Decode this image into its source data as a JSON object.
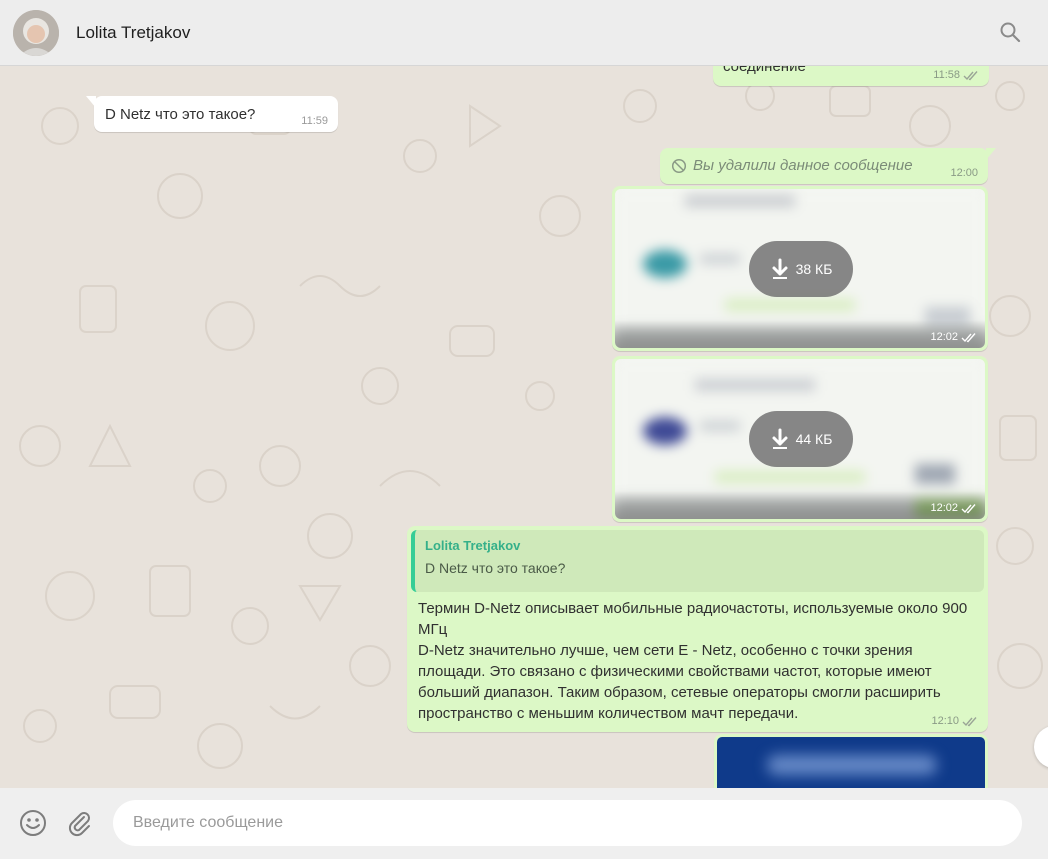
{
  "header": {
    "contact_name": "Lolita Tretjakov",
    "icons": [
      "avatar",
      "search-icon"
    ]
  },
  "messages": [
    {
      "id": "top",
      "direction": "out",
      "text": "соединение",
      "time": "11:58",
      "status": "read"
    },
    {
      "id": "q",
      "direction": "in",
      "text": "D Netz  что это такое?",
      "time": "11:59"
    },
    {
      "id": "del",
      "direction": "out",
      "text": "Вы удалили данное сообщение",
      "time": "12:00"
    },
    {
      "id": "img1",
      "direction": "out",
      "type": "image",
      "size": "38 КБ",
      "time": "12:02",
      "status": "read"
    },
    {
      "id": "img2",
      "direction": "out",
      "type": "image",
      "size": "44 КБ",
      "time": "12:02",
      "status": "read"
    },
    {
      "id": "reply",
      "direction": "out",
      "quote_author": "Lolita Tretjakov",
      "quote_text": "D Netz  что это такое?",
      "text": "Термин D-Netz описывает мобильные радиочастоты, используемые около 900 МГц\nD-Netz значительно лучше, чем сети E - Netz, особенно с точки зрения площади. Это связано с физическими свойствами частот, которые имеют больший диапазон. Таким образом, сетевые операторы смогли расширить пространство с меньшим количеством мачт передачи.",
      "time": "12:10",
      "status": "read"
    }
  ],
  "composer": {
    "placeholder": "Введите сообщение",
    "icons": [
      "emoji-icon",
      "paperclip-icon"
    ]
  },
  "colors": {
    "outgoing_bubble": "#dcf8c6",
    "incoming_bubble": "#ffffff",
    "header_bg": "#ededed",
    "chat_bg": "#e5ddd5",
    "quote_accent": "#35cd96"
  }
}
